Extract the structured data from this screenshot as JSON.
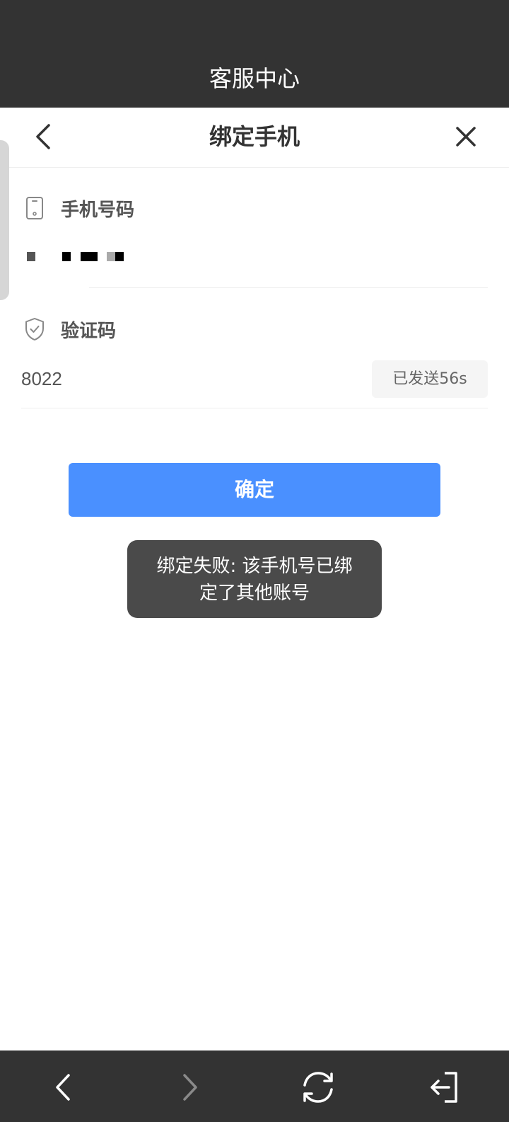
{
  "app_bar": {
    "title": "客服中心"
  },
  "sheet": {
    "title": "绑定手机",
    "back_icon": "chevron-left-icon",
    "close_icon": "close-icon"
  },
  "phone_field": {
    "label": "手机号码",
    "icon": "smartphone-icon"
  },
  "code_field": {
    "label": "验证码",
    "icon": "shield-check-icon",
    "value": "8022",
    "resend_label": "已发送56s"
  },
  "confirm_label": "确定",
  "toast": {
    "line1": "绑定失败: 该手机号已绑",
    "line2": "定了其他账号"
  },
  "bottom_nav": {
    "back_icon": "arrow-back-icon",
    "forward_icon": "arrow-forward-icon",
    "refresh_icon": "refresh-icon",
    "exit_icon": "exit-icon"
  },
  "colors": {
    "bar": "#333333",
    "accent": "#4a90ff",
    "toast": "#4a4a4a"
  }
}
